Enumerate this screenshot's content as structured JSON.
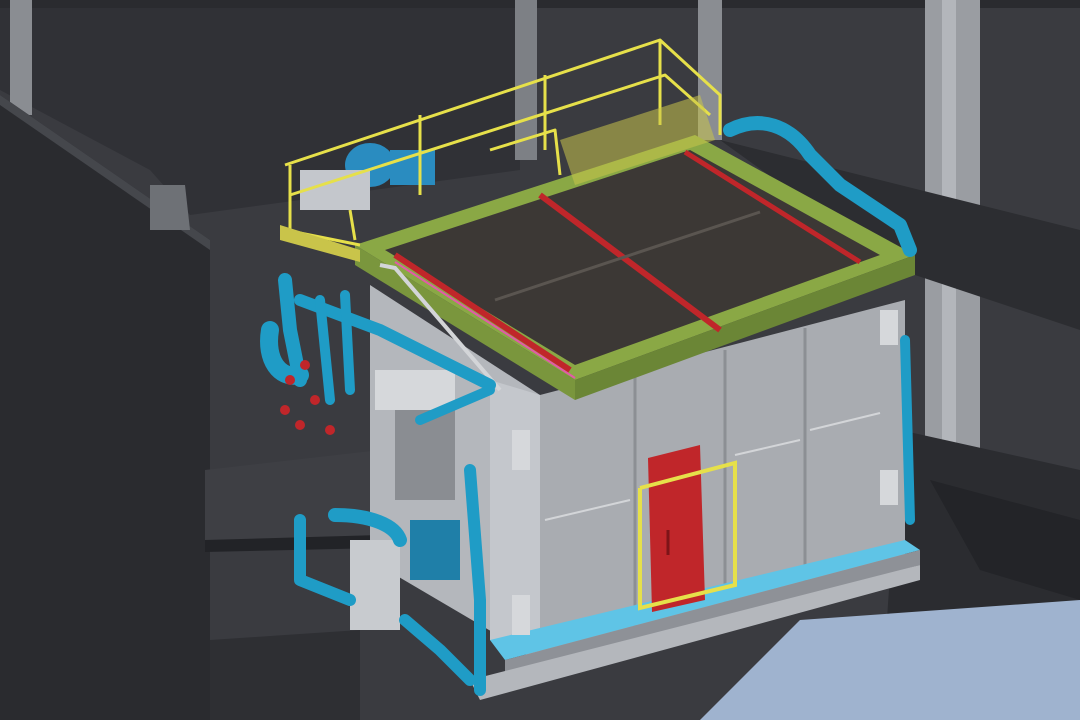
{
  "scene": {
    "colors": {
      "background": "#3a3b40",
      "building_wall": "#2f3034",
      "floor_blue": "#9ab0d0",
      "frame_grey": "#b9bcc1",
      "frame_grey_dark": "#8e9197",
      "top_frame_green": "#8aa845",
      "handrail_yellow": "#e6e04a",
      "pipe_blue": "#1f9cc6",
      "door_red": "#c0262a",
      "strip_red": "#c0262a",
      "media_dark": "#3c3835",
      "base_cyan": "#5fc4e6"
    }
  }
}
